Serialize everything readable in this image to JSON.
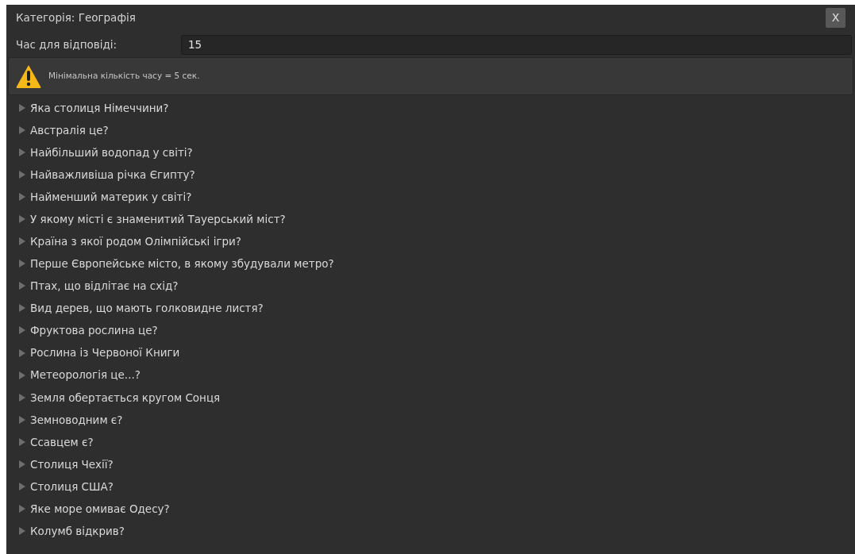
{
  "window": {
    "title": "Категорія: Географія",
    "close_label": "X"
  },
  "time_field": {
    "label": "Час для відповіді:",
    "value": "15"
  },
  "warning": {
    "text": "Мінімальна кількість часу = 5 сек."
  },
  "questions": [
    {
      "label": "Яка столиця Німеччини?",
      "expanded": false
    },
    {
      "label": "Австралія це?",
      "expanded": false
    },
    {
      "label": "Найбільший водопад у світі?",
      "expanded": false
    },
    {
      "label": "Найважливіша річка Єгипту?",
      "expanded": false
    },
    {
      "label": "Найменший материк у світі?",
      "expanded": false
    },
    {
      "label": "У якому місті є знаменитий Тауерський міст?",
      "expanded": false
    },
    {
      "label": "Країна з якої родом Олімпійські ігри?",
      "expanded": false
    },
    {
      "label": "Перше Європейське місто, в якому збудували метро?",
      "expanded": false
    },
    {
      "label": "Птах, що відлітає на схід?",
      "expanded": false
    },
    {
      "label": "Вид дерев, що мають голковидне листя?",
      "expanded": false
    },
    {
      "label": "Фруктова рослина це?",
      "expanded": false
    },
    {
      "label": "Рослина із Червоної Книги",
      "expanded": false
    },
    {
      "label": "Метеорологія це...?",
      "expanded": false
    },
    {
      "label": "Земля обертається кругом Сонця",
      "expanded": false
    },
    {
      "label": "Земноводним є?",
      "expanded": false
    },
    {
      "label": "Ссавцем є?",
      "expanded": false
    },
    {
      "label": "Столиця Чехії?",
      "expanded": false
    },
    {
      "label": "Столиця США?",
      "expanded": false
    },
    {
      "label": "Яке море омиває Одесу?",
      "expanded": false
    },
    {
      "label": "Колумб відкрив?",
      "expanded": false
    }
  ]
}
